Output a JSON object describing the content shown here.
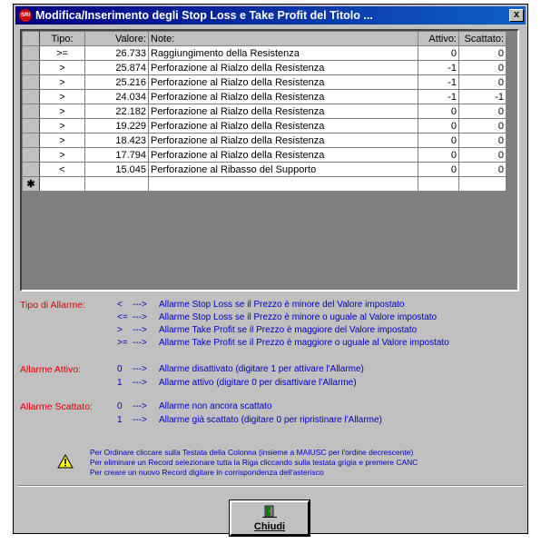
{
  "window": {
    "title": "Modifica/Inserimento degli Stop Loss e Take Profit del Titolo ...",
    "app_icon_text": "SRI",
    "close_label": "x"
  },
  "grid": {
    "headers": {
      "tipo": "Tipo:",
      "valore": "Valore:",
      "note": "Note:",
      "attivo": "Attivo:",
      "scattato": "Scattato:"
    },
    "rows": [
      {
        "tipo": ">=",
        "valore": "26.733",
        "note": "Raggiungimento della Resistenza",
        "attivo": "0",
        "scattato": "0"
      },
      {
        "tipo": ">",
        "valore": "25.874",
        "note": "Perforazione al Rialzo della Resistenza",
        "attivo": "-1",
        "scattato": "0"
      },
      {
        "tipo": ">",
        "valore": "25.216",
        "note": "Perforazione al Rialzo della Resistenza",
        "attivo": "-1",
        "scattato": "0"
      },
      {
        "tipo": ">",
        "valore": "24.034",
        "note": "Perforazione al Rialzo della Resistenza",
        "attivo": "-1",
        "scattato": "-1"
      },
      {
        "tipo": ">",
        "valore": "22.182",
        "note": "Perforazione al Rialzo della Resistenza",
        "attivo": "0",
        "scattato": "0"
      },
      {
        "tipo": ">",
        "valore": "19.229",
        "note": "Perforazione al Rialzo della Resistenza",
        "attivo": "0",
        "scattato": "0"
      },
      {
        "tipo": ">",
        "valore": "18.423",
        "note": "Perforazione al Rialzo della Resistenza",
        "attivo": "0",
        "scattato": "0"
      },
      {
        "tipo": ">",
        "valore": "17.794",
        "note": "Perforazione al Rialzo della Resistenza",
        "attivo": "0",
        "scattato": "0"
      },
      {
        "tipo": "<",
        "valore": "15.045",
        "note": "Perforazione al Ribasso del Supporto",
        "attivo": "0",
        "scattato": "0"
      }
    ],
    "new_record_marker": "✱"
  },
  "legend": {
    "tipo_label": "Tipo di Allarme:",
    "tipo_items": [
      {
        "sym": "<",
        "arrow": "--->",
        "text": "Allarme Stop Loss se il Prezzo è minore del Valore impostato"
      },
      {
        "sym": "<=",
        "arrow": "--->",
        "text": "Allarme Stop Loss se il Prezzo è minore o uguale al Valore impostato"
      },
      {
        "sym": ">",
        "arrow": "--->",
        "text": "Allarme Take Profit se il Prezzo è maggiore del Valore impostato"
      },
      {
        "sym": ">=",
        "arrow": "--->",
        "text": "Allarme Take Profit se il Prezzo è maggiore o uguale al Valore impostato"
      }
    ],
    "attivo_label": "Allarme Attivo:",
    "attivo_items": [
      {
        "sym": "0",
        "arrow": "--->",
        "text": "Allarme disattivato (digitare 1 per attivare l'Allarme)"
      },
      {
        "sym": "1",
        "arrow": "--->",
        "text": "Allarme attivo (digitare 0 per disattivare l'Allarme)"
      }
    ],
    "scattato_label": "Allarme Scattato:",
    "scattato_items": [
      {
        "sym": "0",
        "arrow": "--->",
        "text": "Allarme non ancora scattato"
      },
      {
        "sym": "1",
        "arrow": "--->",
        "text": "Allarme già scattato (digitare 0 per ripristinare l'Allarme)"
      }
    ]
  },
  "notes": [
    "Per Ordinare cliccare sulla Testata della Colonna (insieme a MAIUSC per l'ordine decrescente)",
    "Per eliminare un Record selezionare tutta la Riga cliccando sulla testata grigia e premere CANC",
    "Per creare un nuovo Record digitare in corrispondenza dell'asterisco"
  ],
  "buttons": {
    "close": "Chiudi"
  },
  "colors": {
    "titlebar": "#000080",
    "legend_label": "#e00000",
    "legend_text": "#0000c0"
  },
  "icons": {
    "warning": "warning-icon",
    "close_button": "exit-door-icon"
  }
}
